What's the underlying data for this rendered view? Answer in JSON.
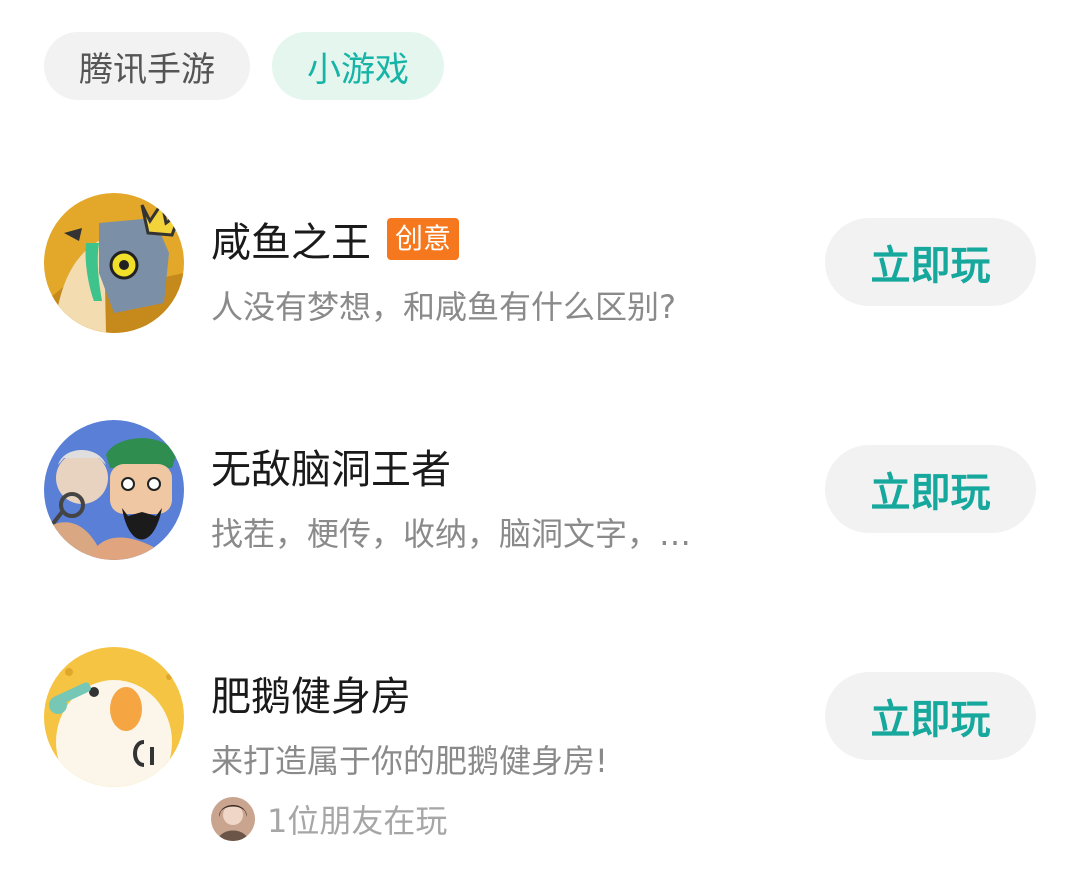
{
  "tabs": [
    {
      "label": "腾讯手游",
      "active": false
    },
    {
      "label": "小游戏",
      "active": true
    }
  ],
  "games": [
    {
      "title": "咸鱼之王",
      "badge": "创意",
      "description": "人没有梦想，和咸鱼有什么区别?",
      "button": "立即玩",
      "icon": "salted-fish-king-icon"
    },
    {
      "title": "无敌脑洞王者",
      "description": "找茬，梗传，收纳，脑洞文字，…",
      "button": "立即玩",
      "icon": "brain-hole-king-icon"
    },
    {
      "title": "肥鹅健身房",
      "description": "来打造属于你的肥鹅健身房!",
      "button": "立即玩",
      "icon": "fat-goose-gym-icon",
      "friends_text": "1位朋友在玩"
    }
  ],
  "colors": {
    "accent": "#16b4a6",
    "active_tab_bg": "#e4f6ee",
    "badge": "#f5781f",
    "button_bg": "#f2f2f2"
  }
}
